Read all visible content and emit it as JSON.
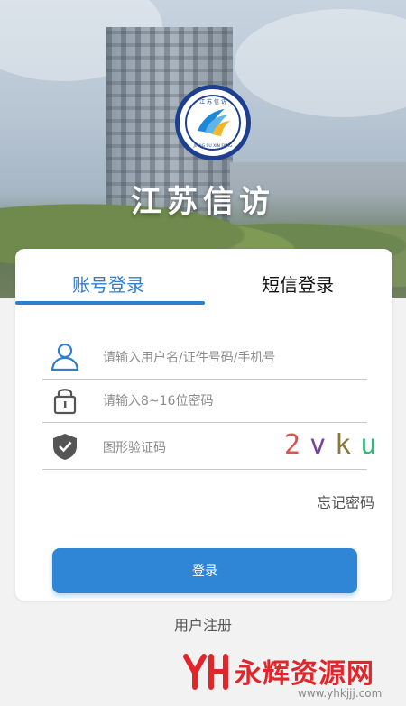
{
  "header": {
    "app_name": "江苏信访",
    "logo_text_top": "江 苏 信 访",
    "logo_text_bottom": "JIANG SU XIN FANG"
  },
  "tabs": {
    "account_label": "账号登录",
    "sms_label": "短信登录"
  },
  "form": {
    "username_placeholder": "请输入用户名/证件号码/手机号",
    "password_placeholder": "请输入8~16位密码",
    "captcha_placeholder": "图形验证码",
    "captcha_chars": [
      "2",
      "v",
      "k",
      "u"
    ]
  },
  "links": {
    "forgot_password": "忘记密码",
    "register": "用户注册"
  },
  "buttons": {
    "login": "登录"
  },
  "watermark": {
    "brand": "永辉资源网",
    "url": "www.yhkjjj.com"
  },
  "colors": {
    "accent": "#2f7ecf",
    "button": "#2f86d6",
    "captcha": [
      "#d9534f",
      "#7a3fa0",
      "#8a7a3a",
      "#3bb37a"
    ]
  }
}
